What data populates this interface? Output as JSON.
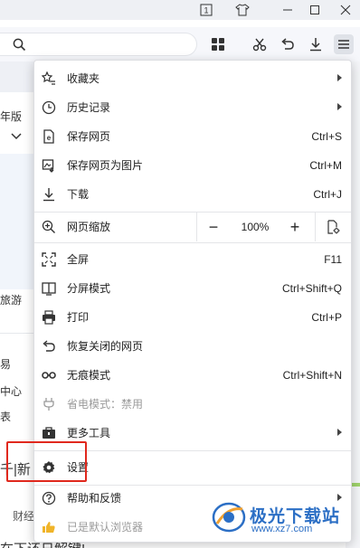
{
  "window": {
    "title_icons": [
      "tab-count-icon",
      "skin-icon",
      "minimize-icon",
      "maximize-icon",
      "close-icon"
    ],
    "tab_count": "1"
  },
  "toolbar": {
    "search": {
      "value": "",
      "placeholder": ""
    },
    "icons": [
      "apps-grid-icon",
      "scissors-icon",
      "undo-icon",
      "download-icon",
      "menu-icon"
    ]
  },
  "background_page": {
    "fragments": [
      "年版",
      "旅游",
      "易",
      "中心",
      "表",
      "千|新",
      "财经",
      "在下还日解键!"
    ]
  },
  "menu": {
    "items": [
      {
        "id": "favorites",
        "label": "收藏夹",
        "icon": "star-list-icon",
        "shortcut": "",
        "submenu": true
      },
      {
        "id": "history",
        "label": "历史记录",
        "icon": "clock-icon",
        "shortcut": "",
        "submenu": true
      },
      {
        "id": "save-page",
        "label": "保存网页",
        "icon": "save-page-icon",
        "shortcut": "Ctrl+S",
        "submenu": false
      },
      {
        "id": "save-as-image",
        "label": "保存网页为图片",
        "icon": "image-save-icon",
        "shortcut": "Ctrl+M",
        "submenu": false
      },
      {
        "id": "downloads",
        "label": "下载",
        "icon": "download-icon",
        "shortcut": "Ctrl+J",
        "submenu": false
      },
      {
        "id": "zoom",
        "label": "网页缩放",
        "icon": "zoom-icon",
        "zoom_value": "100%",
        "zoom_minus": "−",
        "zoom_plus": "+"
      },
      {
        "id": "fullscreen",
        "label": "全屏",
        "icon": "fullscreen-icon",
        "shortcut": "F11",
        "submenu": false
      },
      {
        "id": "split-screen",
        "label": "分屏模式",
        "icon": "split-screen-icon",
        "shortcut": "Ctrl+Shift+Q",
        "submenu": false
      },
      {
        "id": "print",
        "label": "打印",
        "icon": "printer-icon",
        "shortcut": "Ctrl+P",
        "submenu": false
      },
      {
        "id": "restore-closed",
        "label": "恢复关闭的网页",
        "icon": "restore-icon",
        "shortcut": "",
        "submenu": false
      },
      {
        "id": "incognito",
        "label": "无痕模式",
        "icon": "incognito-icon",
        "shortcut": "Ctrl+Shift+N",
        "submenu": false
      },
      {
        "id": "power-saver",
        "label": "省电模式：禁用",
        "icon": "plug-icon",
        "shortcut": "",
        "submenu": false,
        "disabled": true
      },
      {
        "id": "more-tools",
        "label": "更多工具",
        "icon": "toolbox-icon",
        "shortcut": "",
        "submenu": true
      },
      {
        "id": "settings",
        "label": "设置",
        "icon": "gear-icon",
        "shortcut": "",
        "submenu": false
      },
      {
        "id": "help",
        "label": "帮助和反馈",
        "icon": "help-icon",
        "shortcut": "",
        "submenu": true
      },
      {
        "id": "default-browser",
        "label": "已是默认浏览器",
        "icon": "thumbs-up-icon",
        "shortcut": "",
        "submenu": false,
        "disabled": true
      }
    ]
  },
  "highlight": {
    "target": "settings",
    "color": "#e0281d"
  },
  "watermark": {
    "text": "极光下载站",
    "url": "www.xz7.com"
  },
  "colors": {
    "accent": "#2c6fc5",
    "highlight": "#e0281d",
    "toolbar_bg": "#f6f7fb"
  }
}
